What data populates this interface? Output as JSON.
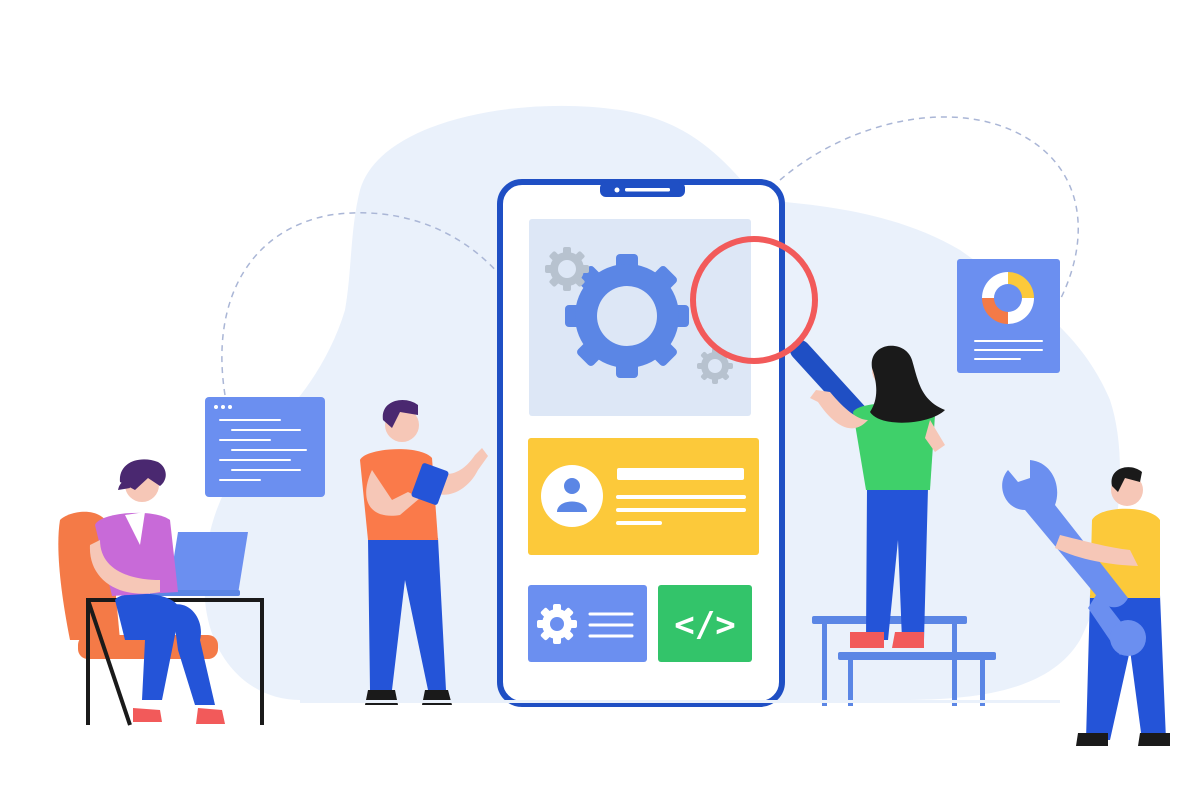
{
  "illustration": {
    "code_symbol": "</>",
    "colors": {
      "phone_frame": "#1f4fc4",
      "phone_screen_top": "#dde7f6",
      "gear_main": "#5b86e5",
      "gear_small": "#b7c2cf",
      "profile_card": "#fcc93a",
      "settings_tile": "#6b8ff0",
      "code_tile": "#33c46a",
      "magnifier_ring": "#f25a5a",
      "magnifier_handle": "#1f4fc4",
      "background_blob": "#eaf1fb",
      "shirt_purple": "#c86ad8",
      "shirt_orange": "#fa7a4a",
      "shirt_green": "#3fd06a",
      "shirt_yellow": "#fcc93a",
      "pants_blue": "#2454d8",
      "chair_orange": "#f47a47"
    },
    "icons": [
      "gear-icon",
      "user-avatar-icon",
      "code-icon",
      "donut-chart-icon",
      "wrench-icon",
      "magnifying-glass-icon"
    ],
    "figures": [
      "person-with-laptop",
      "person-with-tablet",
      "person-with-magnifier",
      "person-with-wrench"
    ]
  }
}
